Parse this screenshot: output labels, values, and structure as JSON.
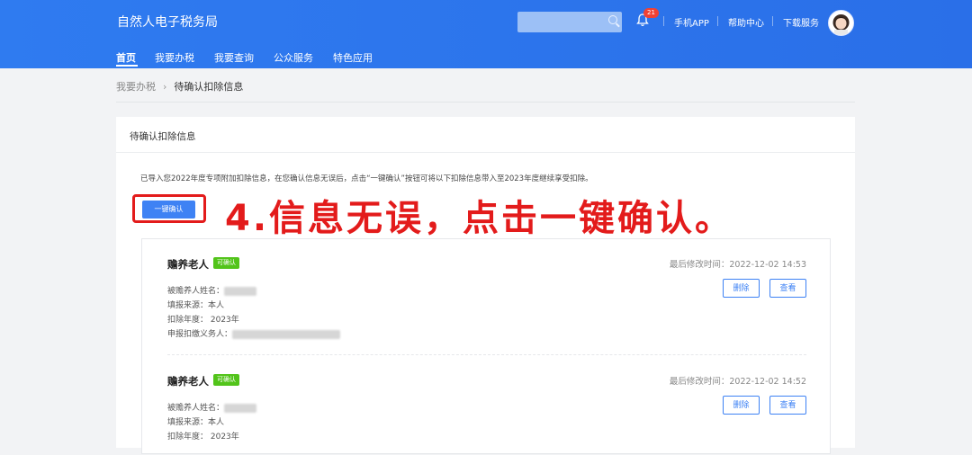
{
  "header": {
    "brand": "自然人电子税务局",
    "notification_count": "21",
    "links": [
      "手机APP",
      "帮助中心",
      "下载服务"
    ]
  },
  "nav": {
    "items": [
      "首页",
      "我要办税",
      "我要查询",
      "公众服务",
      "特色应用"
    ],
    "active": "首页"
  },
  "breadcrumb": {
    "parent": "我要办税",
    "current": "待确认扣除信息"
  },
  "panel": {
    "title": "待确认扣除信息",
    "notice": "已导入您2022年度专项附加扣除信息，在您确认信息无误后，点击“一键确认”按钮可将以下扣除信息带入至2023年度继续享受扣除。",
    "confirm_label": "一键确认",
    "annotation": "4.信息无误，点击一键确认。"
  },
  "records": [
    {
      "title": "赡养老人",
      "tag": "可确认",
      "modified": "最后修改时间：2022-12-02 14:53",
      "fields": {
        "name_label": "被赡养人姓名：",
        "source": "填报来源：本人",
        "year": "扣除年度： 2023年",
        "agent_label": "申报扣缴义务人："
      },
      "delete_label": "删除",
      "view_label": "查看"
    },
    {
      "title": "赡养老人",
      "tag": "可确认",
      "modified": "最后修改时间：2022-12-02 14:52",
      "fields": {
        "name_label": "被赡养人姓名：",
        "source": "填报来源：本人",
        "year": "扣除年度： 2023年"
      },
      "delete_label": "删除",
      "view_label": "查看"
    }
  ],
  "colors": {
    "header": "#2f7bf0",
    "accent": "#3e82f4",
    "annotation": "#e31b1b",
    "tag": "#52c41a"
  }
}
